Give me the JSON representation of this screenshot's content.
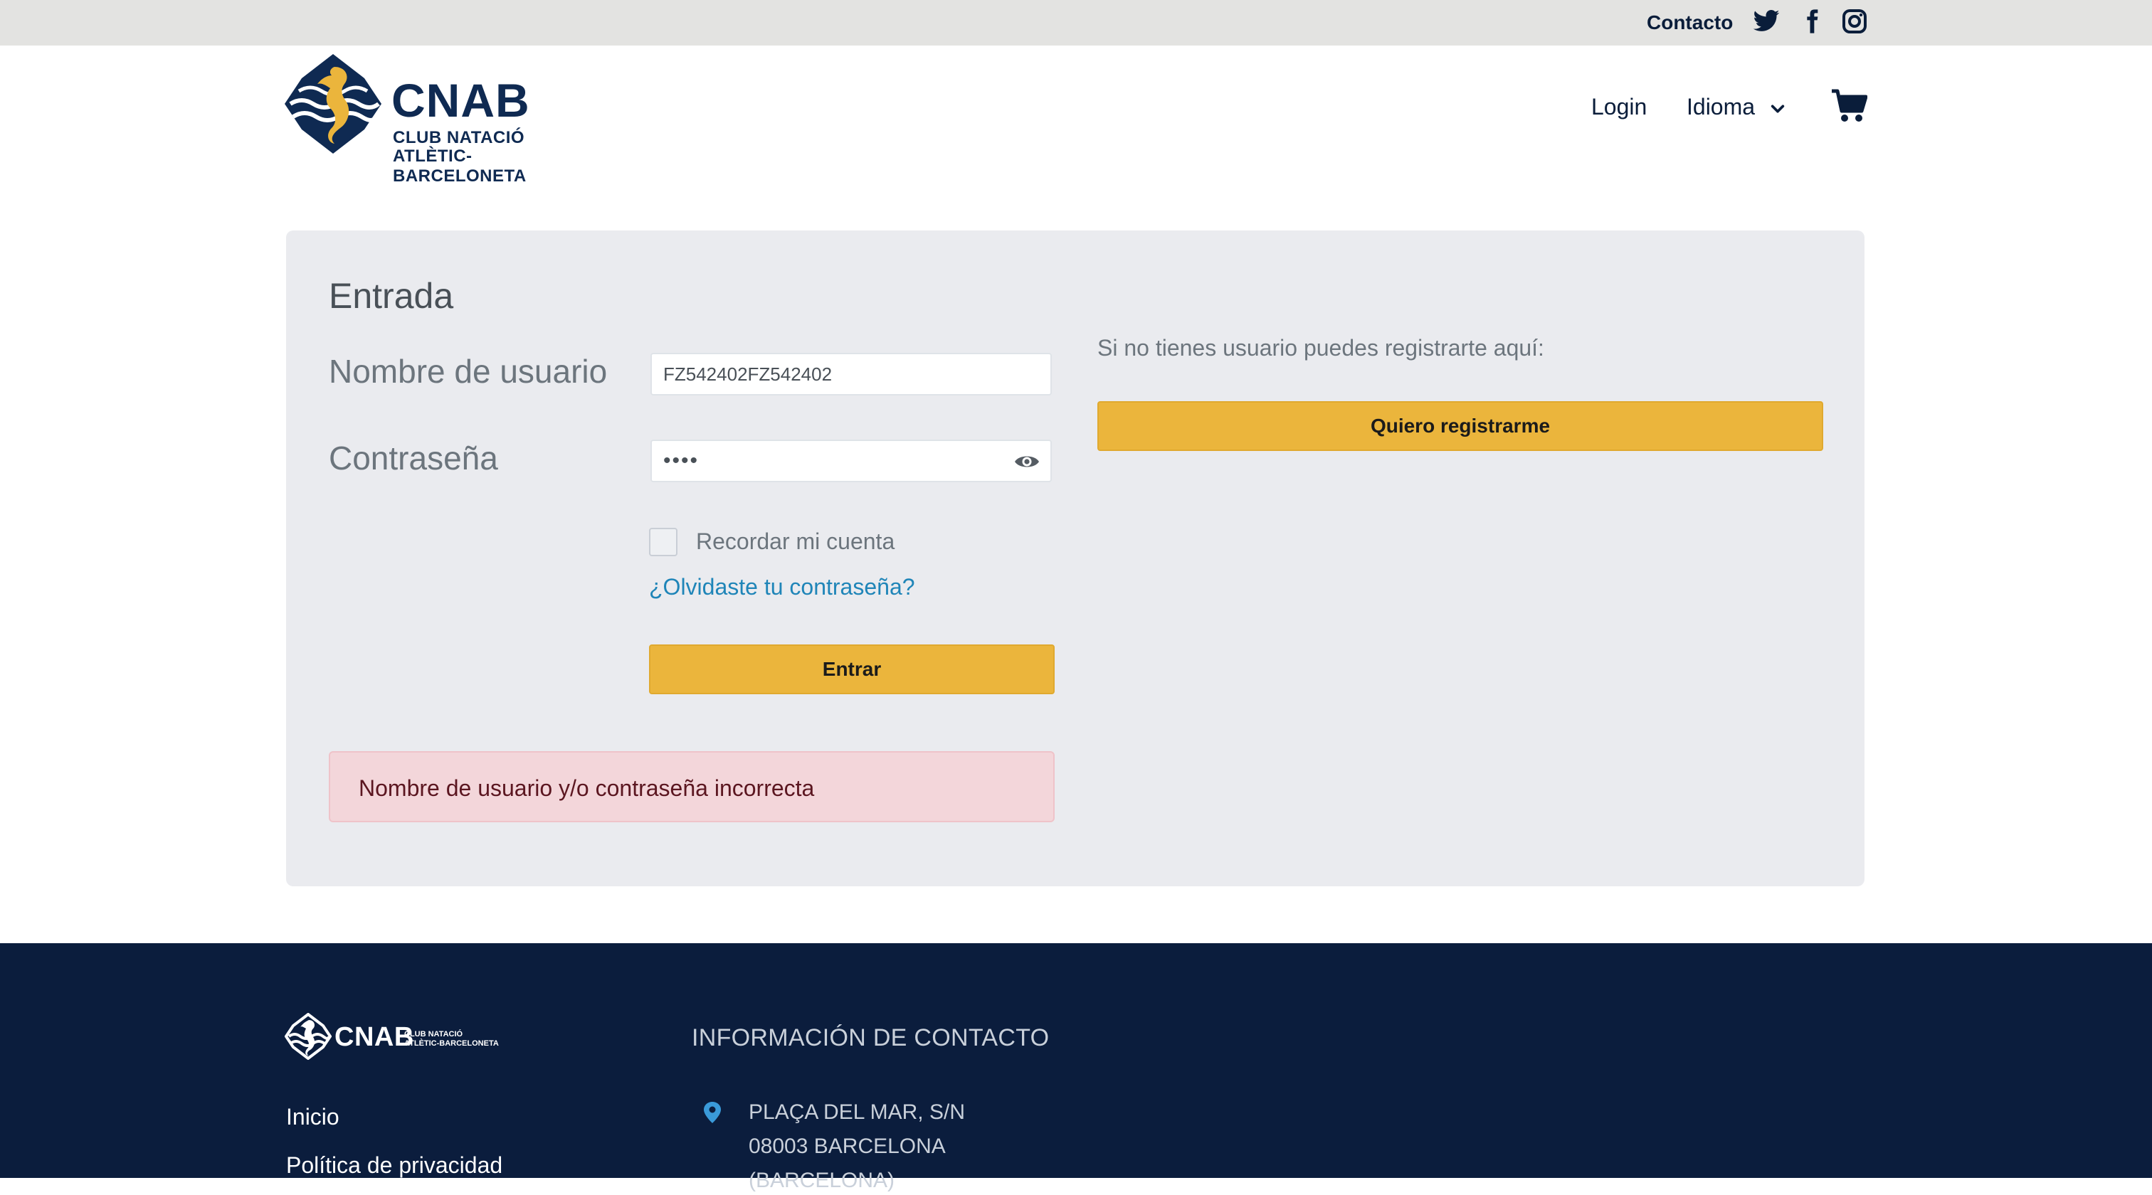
{
  "topbar": {
    "contact_label": "Contacto",
    "social_icons": [
      "twitter-icon",
      "facebook-icon",
      "instagram-icon"
    ]
  },
  "logo": {
    "brand": "CNAB",
    "subtitle_line1": "CLUB NATACIÓ",
    "subtitle_line2": "ATLÈTIC-BARCELONETA"
  },
  "nav": {
    "login_label": "Login",
    "language_label": "Idioma",
    "cart_icon": "shopping-cart-icon"
  },
  "login": {
    "title": "Entrada",
    "username_label": "Nombre de usuario",
    "username_value": "FZ542402FZ542402",
    "password_label": "Contraseña",
    "password_value": "••••",
    "remember_label": "Recordar mi cuenta",
    "forgot_label": "¿Olvidaste tu contraseña?",
    "submit_label": "Entrar",
    "error_message": "Nombre de usuario y/o contraseña incorrecta"
  },
  "register": {
    "prompt": "Si no tienes usuario puedes registrarte aquí:",
    "button_label": "Quiero registrarme"
  },
  "footer": {
    "brand": "CNAB",
    "subtitle_line1": "CLUB NATACIÓ",
    "subtitle_line2": "ATLÈTIC-BARCELONETA",
    "links": [
      "Inicio",
      "Política de privacidad"
    ],
    "contact_heading": "INFORMACIÓN DE CONTACTO",
    "address_lines": [
      "PLAÇA DEL MAR, S/N",
      "08003 BARCELONA",
      "(BARCELONA)"
    ]
  },
  "colors": {
    "navy": "#0a1d3a",
    "accent_yellow": "#ebb53c",
    "card_bg": "#eaebef",
    "link_blue": "#1f85b8",
    "error_bg": "#f3d6da",
    "footer_bg": "#0b1d3d",
    "pin_blue": "#3a9ad9"
  }
}
